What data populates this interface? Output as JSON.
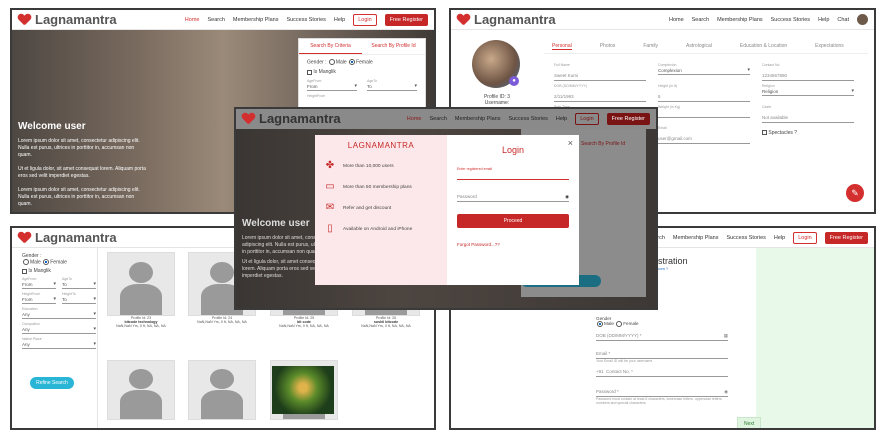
{
  "brand": "Lagnamantra",
  "nav": {
    "home": "Home",
    "search": "Search",
    "plans": "Membership Plans",
    "stories": "Success Stories",
    "help": "Help",
    "chat": "Chat",
    "login": "Login",
    "register": "Free Register"
  },
  "hero": {
    "title": "Welcome user",
    "p1": "Lorem ipsum dolor sit amet, consectetur adipiscing elit. Nulla est purus, ultrices in porttitor in, accumsan non quam.",
    "p2": "Ut et ligula dolor, sit amet consequat lorem. Aliquam porta eros sed velit imperdiet egestas.",
    "p3": "Lorem ipsum dolor sit amet, consectetur adipiscing elit. Nulla est purus, ultrices in porttitor in, accumsan non quam."
  },
  "search": {
    "tab_criteria": "Search By Criteria",
    "tab_id": "Search By Profile Id",
    "gender": "Gender :",
    "male": "Male",
    "female": "Female",
    "manglik": "Is Manglik",
    "age_from": "AgeFrom",
    "age_to": "AgeTo",
    "from": "From",
    "to": "To",
    "height_from": "HeightFrom",
    "height_to": "HeightTo",
    "education": "Education",
    "occupation": "Occupation",
    "native": "Native Place",
    "any": "Any",
    "refine": "Refine Search",
    "search_btn": "Search"
  },
  "profile": {
    "id": "Profile ID: 3",
    "username": "Username:",
    "tabs": [
      "Personal",
      "Photos",
      "Family",
      "Astrological",
      "Education & Location",
      "Expectations"
    ],
    "fields": [
      {
        "label": "Full Name",
        "value": "Sweet Kumi"
      },
      {
        "label": "Complexion",
        "value": "Complexion"
      },
      {
        "label": "Contact No",
        "value": "1234567890"
      },
      {
        "label": "DOB (DD/MM/YYYY)",
        "value": "2/11/1993"
      },
      {
        "label": "Height (in ft)",
        "value": "5"
      },
      {
        "label": "Religion",
        "value": "Religion"
      },
      {
        "label": "Birth Time",
        "value": "10:45 AM"
      },
      {
        "label": "Weight (in Kg)",
        "value": ""
      },
      {
        "label": "Caste",
        "value": "Not available"
      },
      {
        "label": "Marital Status",
        "value": "Single"
      },
      {
        "label": "Email",
        "value": "user@gmail.com"
      },
      {
        "label": "Spectacles ?",
        "value": "Spectacles ?"
      }
    ]
  },
  "results": [
    {
      "id": "Profile Id: 23",
      "name": "bitcode technology",
      "info": "NaN,NaN Yrs, 0 ft, NA, NA, NA"
    },
    {
      "id": "Profile Id: 24",
      "name": "",
      "info": "NaN,NaN Yrs, 0 ft, NA, NA, NA"
    },
    {
      "id": "Profile Id: 25",
      "name": "bit code",
      "info": "NaN,NaN Yrs, 0 ft, NA, NA, NA"
    },
    {
      "id": "Profile Id: 26",
      "name": "sushil bitcode",
      "info": "NaN,NaN Yrs, 0 ft, NA, NA, NA"
    }
  ],
  "modal": {
    "brand": "LAGNAMANTRA",
    "title": "Login",
    "features": [
      "More than 10,000 users",
      "More than 50 membership plans",
      "Refer and get discount",
      "Available on Android and iPhone"
    ],
    "email_label": "Enter registered email",
    "password": "Password",
    "proceed": "Proceed",
    "forgot": "Forgot Password...??",
    "close": "×"
  },
  "register": {
    "title": "gistration",
    "sub": "we.com ?",
    "gender": "Gender",
    "male": "Male",
    "female": "Female",
    "dob": "DOB (DD/MM/YYYY) *",
    "email": "Email *",
    "email_hint": "Your Email ID will be your username",
    "code": "+91",
    "contact": "Contact No. *",
    "password": "Password *",
    "pw_hint": "Password must contain at least 8 characters, lowercase letters, uppercase letters, numbers and special characters",
    "next": "Next"
  }
}
